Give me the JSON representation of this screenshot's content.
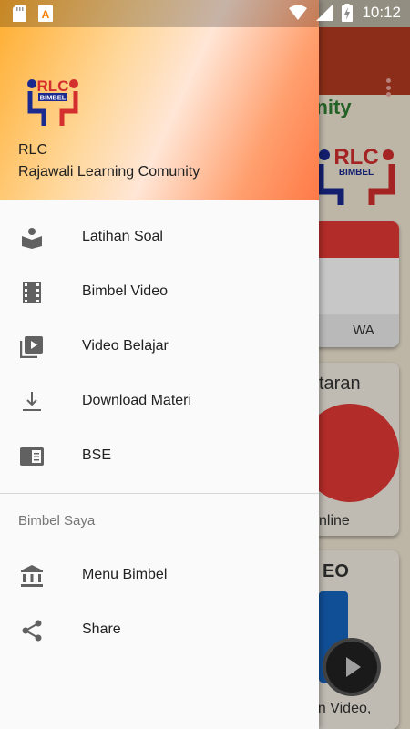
{
  "status_bar": {
    "time": "10:12",
    "icons": [
      "sd-card-icon",
      "notification-a-icon",
      "wifi-icon",
      "signal-icon",
      "battery-charging-icon"
    ]
  },
  "background_app": {
    "title_fragment": "omunity",
    "logo_text": "RLC",
    "logo_subtext": "BIMBEL",
    "cards": [
      {
        "label": "WA"
      },
      {
        "title_fragment": "taran",
        "label": "nline"
      },
      {
        "title_fragment": "EO",
        "label": "an Video,"
      }
    ]
  },
  "drawer": {
    "header": {
      "logo_text": "RLC",
      "logo_subtext": "BIMBEL",
      "name": "RLC",
      "subtitle": "Rajawali Learning Comunity"
    },
    "menu_items": [
      {
        "label": "Latihan Soal",
        "icon": "book-reader-icon"
      },
      {
        "label": "Bimbel Video",
        "icon": "film-strip-icon"
      },
      {
        "label": "Video Belajar",
        "icon": "video-library-icon"
      },
      {
        "label": "Download Materi",
        "icon": "download-icon"
      },
      {
        "label": "BSE",
        "icon": "book-icon"
      }
    ],
    "section_title": "Bimbel Saya",
    "section_items": [
      {
        "label": "Menu Bimbel",
        "icon": "bank-icon"
      },
      {
        "label": "Share",
        "icon": "share-icon"
      }
    ]
  },
  "colors": {
    "header_gradient_start": "#ffad2e",
    "header_gradient_end": "#ff7a47",
    "background_appbar": "#b23a1f",
    "icon_gray": "#616161",
    "text_primary": "#212121",
    "text_secondary": "#757575"
  }
}
